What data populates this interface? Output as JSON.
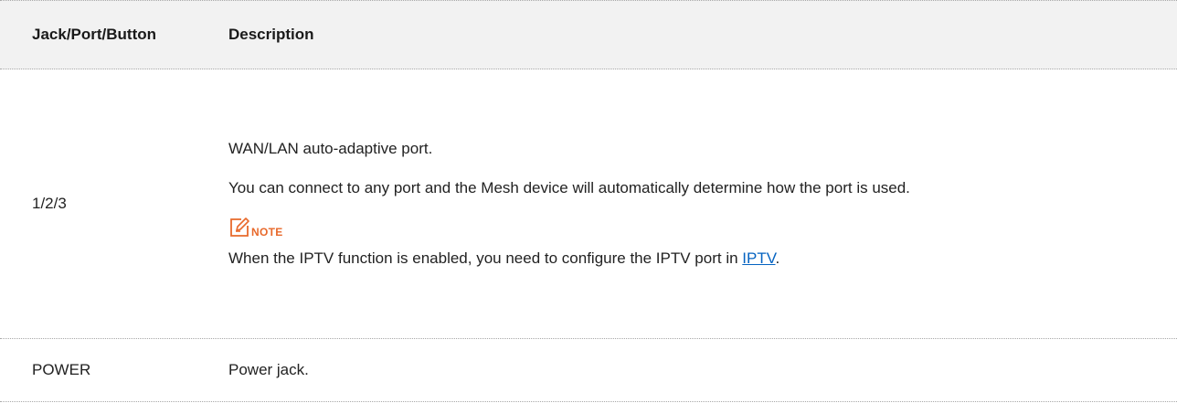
{
  "table": {
    "headers": {
      "col1": "Jack/Port/Button",
      "col2": "Description"
    },
    "rows": [
      {
        "name": "1/2/3",
        "description": {
          "line1": "WAN/LAN auto-adaptive port.",
          "line2": "You can connect to any port and the Mesh device will automatically determine how the port is used.",
          "note_icon": "note-edit-icon",
          "note_label": "NOTE",
          "note_text_before": "When the IPTV function is enabled, you need to configure the IPTV port in ",
          "note_link": "IPTV",
          "note_text_after": "."
        }
      },
      {
        "name": "POWER",
        "description": {
          "line1": "Power jack."
        }
      }
    ]
  },
  "colors": {
    "note_accent": "#e8692b",
    "link": "#0563c1",
    "header_bg": "#f2f2f2"
  }
}
